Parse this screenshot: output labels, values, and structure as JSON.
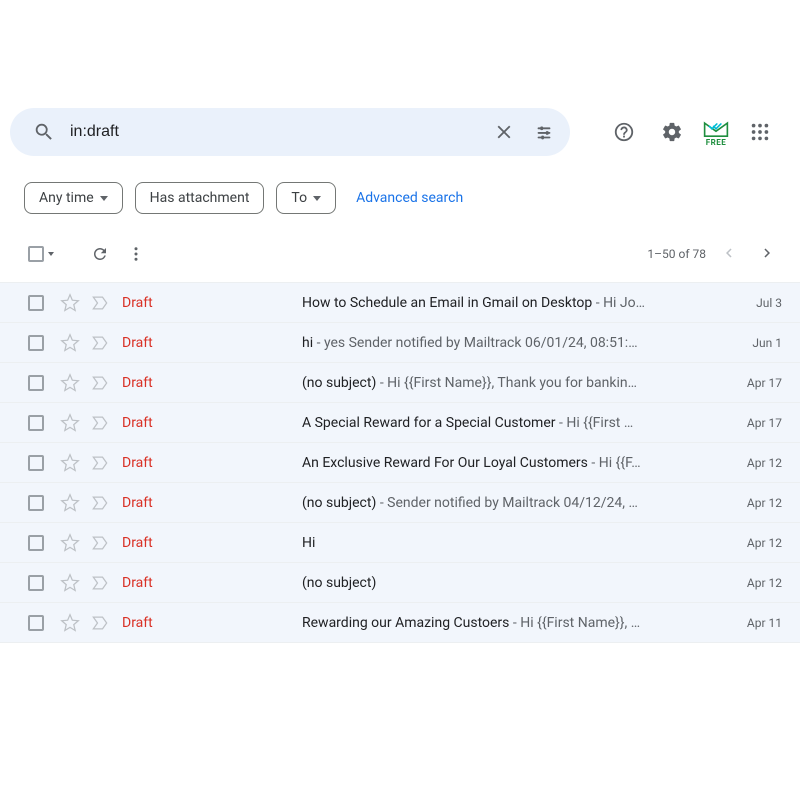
{
  "search": {
    "query": "in:draft"
  },
  "filters": {
    "anytime": "Any time",
    "has_attachment": "Has attachment",
    "to": "To",
    "advanced": "Advanced search"
  },
  "toolbar": {
    "page_info": "1–50 of 78"
  },
  "rows": [
    {
      "sender": "Draft",
      "subject": "How to Schedule an Email in Gmail on Desktop",
      "snippet": "Hi Jo…",
      "date": "Jul 3"
    },
    {
      "sender": "Draft",
      "subject": "hi",
      "snippet": "yes Sender notified by Mailtrack 06/01/24, 08:51:…",
      "date": "Jun 1"
    },
    {
      "sender": "Draft",
      "subject": "(no subject)",
      "snippet": "Hi {{First Name}}, Thank you for bankin…",
      "date": "Apr 17"
    },
    {
      "sender": "Draft",
      "subject": "A Special Reward for a Special Customer",
      "snippet": "Hi {{First …",
      "date": "Apr 17"
    },
    {
      "sender": "Draft",
      "subject": "An Exclusive Reward For Our Loyal Customers",
      "snippet": "Hi {{F…",
      "date": "Apr 12"
    },
    {
      "sender": "Draft",
      "subject": "(no subject)",
      "snippet": "Sender notified by Mailtrack 04/12/24, …",
      "date": "Apr 12"
    },
    {
      "sender": "Draft",
      "subject": "Hi",
      "snippet": "",
      "date": "Apr 12"
    },
    {
      "sender": "Draft",
      "subject": "(no subject)",
      "snippet": "",
      "date": "Apr 12"
    },
    {
      "sender": "Draft",
      "subject": "Rewarding our Amazing Custoers",
      "snippet": "Hi {{First Name}}, …",
      "date": "Apr 11"
    }
  ],
  "ext_label": "FREE"
}
